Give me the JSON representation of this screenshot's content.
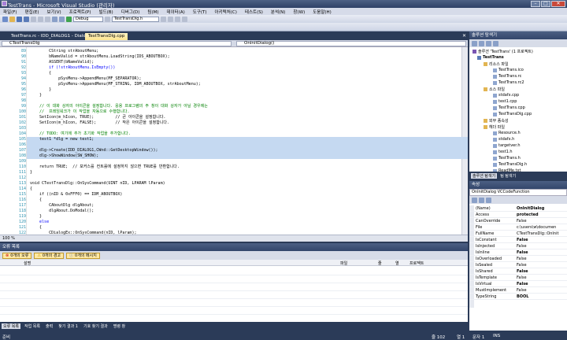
{
  "window": {
    "title": "TestTrans - Microsoft Visual Studio (관리자)"
  },
  "menu": [
    "파일(F)",
    "편집(E)",
    "보기(V)",
    "프로젝트(P)",
    "빌드(B)",
    "디버그(D)",
    "팀(M)",
    "데이터(A)",
    "도구(T)",
    "아키텍처(C)",
    "테스트(S)",
    "분석(N)",
    "창(W)",
    "도움말(H)"
  ],
  "toolbar": {
    "config": "Debug",
    "target": "TestTransDlg.h"
  },
  "tabs": [
    "TestTrans.rc - IDD_DIALOG1 - Dialog",
    "TestTransDlg.cpp"
  ],
  "nav": {
    "class": "CTestTransDlg",
    "member": "OnInitDialog()"
  },
  "code": [
    {
      "n": "89",
      "t": "        CString strAboutMenu;",
      "c": ""
    },
    {
      "n": "90",
      "t": "        bNameValid = strAboutMenu.LoadString(IDS_ABOUTBOX);",
      "c": ""
    },
    {
      "n": "91",
      "t": "        ASSERT(bNameValid);",
      "c": ""
    },
    {
      "n": "92",
      "t": "        if (!strAboutMenu.IsEmpty())",
      "c": "kw"
    },
    {
      "n": "93",
      "t": "        {",
      "c": ""
    },
    {
      "n": "94",
      "t": "            pSysMenu->AppendMenu(MF_SEPARATOR);",
      "c": ""
    },
    {
      "n": "95",
      "t": "            pSysMenu->AppendMenu(MF_STRING, IDM_ABOUTBOX, strAboutMenu);",
      "c": ""
    },
    {
      "n": "96",
      "t": "        }",
      "c": ""
    },
    {
      "n": "97",
      "t": "    }",
      "c": ""
    },
    {
      "n": "98",
      "t": "",
      "c": ""
    },
    {
      "n": "99",
      "t": "    // 이 대화 상자의 아이콘을 설정합니다. 응용 프로그램의 주 창이 대화 상자가 아닐 경우에는",
      "c": "cm"
    },
    {
      "n": "100",
      "t": "    //  프레임워크가 이 작업을 자동으로 수행합니다.",
      "c": "cm"
    },
    {
      "n": "101",
      "t": "    SetIcon(m_hIcon, TRUE);         // 큰 아이콘을 설정합니다.",
      "c": ""
    },
    {
      "n": "102",
      "t": "    SetIcon(m_hIcon, FALSE);        // 작은 아이콘을 설정합니다.",
      "c": ""
    },
    {
      "n": "103",
      "t": "",
      "c": ""
    },
    {
      "n": "104",
      "t": "    // TODO: 여기에 추가 초기화 작업을 추가합니다.",
      "c": "cm"
    },
    {
      "n": "105",
      "t": "    test1 *dlg = new test1;",
      "c": ""
    },
    {
      "n": "106",
      "t": "",
      "c": ""
    },
    {
      "n": "107",
      "t": "    dlg->Create(IDD_DIALOG1,CWnd::GetDesktopWindow());",
      "c": ""
    },
    {
      "n": "108",
      "t": "    dlg->ShowWindow(SW_SHOW);",
      "c": ""
    },
    {
      "n": "109",
      "t": "",
      "c": ""
    },
    {
      "n": "110",
      "t": "    return TRUE;  // 포커스를 컨트롤에 설정하지 않으면 TRUE를 반환합니다.",
      "c": ""
    },
    {
      "n": "111",
      "t": "}",
      "c": ""
    },
    {
      "n": "112",
      "t": "",
      "c": ""
    },
    {
      "n": "113",
      "t": "void CTestTransDlg::OnSysCommand(UINT nID, LPARAM lParam)",
      "c": ""
    },
    {
      "n": "114",
      "t": "{",
      "c": ""
    },
    {
      "n": "115",
      "t": "    if ((nID & 0xFFF0) == IDM_ABOUTBOX)",
      "c": ""
    },
    {
      "n": "116",
      "t": "    {",
      "c": ""
    },
    {
      "n": "117",
      "t": "        CAboutDlg dlgAbout;",
      "c": ""
    },
    {
      "n": "118",
      "t": "        dlgAbout.DoModal();",
      "c": ""
    },
    {
      "n": "119",
      "t": "    }",
      "c": ""
    },
    {
      "n": "120",
      "t": "    else",
      "c": "kw"
    },
    {
      "n": "121",
      "t": "    {",
      "c": ""
    },
    {
      "n": "122",
      "t": "        CDialogEx::OnSysCommand(nID, lParam);",
      "c": ""
    },
    {
      "n": "123",
      "t": "    }",
      "c": ""
    }
  ],
  "selected_lines": [
    "105",
    "106",
    "107",
    "108"
  ],
  "zoom": "100 %",
  "errorlist": {
    "title": "오류 목록",
    "errors": "0개의 오류",
    "warnings": "0개의 경고",
    "messages": "0개의 메시지",
    "columns": [
      "설명",
      "파일",
      "줄",
      "열",
      "프로젝트"
    ]
  },
  "bottom_tabs": [
    "오류 목록",
    "작업 목록",
    "출력",
    "찾기 결과 1",
    "기호 찾기 결과",
    "명령 창"
  ],
  "solution": {
    "title": "솔루션 탐색기",
    "items": [
      {
        "label": "솔루션 'TestTrans' (1 프로젝트)",
        "kind": "sln"
      },
      {
        "label": "TestTrans",
        "kind": "proj"
      },
      {
        "label": "리소스 파일",
        "kind": "folder"
      },
      {
        "label": "TestTrans.ico",
        "kind": "file"
      },
      {
        "label": "TestTrans.rc",
        "kind": "file"
      },
      {
        "label": "TestTrans.rc2",
        "kind": "file"
      },
      {
        "label": "소스 파일",
        "kind": "folder"
      },
      {
        "label": "stdafx.cpp",
        "kind": "file"
      },
      {
        "label": "test1.cpp",
        "kind": "file"
      },
      {
        "label": "TestTrans.cpp",
        "kind": "file"
      },
      {
        "label": "TestTransDlg.cpp",
        "kind": "file"
      },
      {
        "label": "외부 종속성",
        "kind": "folder"
      },
      {
        "label": "헤더 파일",
        "kind": "folder"
      },
      {
        "label": "Resource.h",
        "kind": "file"
      },
      {
        "label": "stdafx.h",
        "kind": "file"
      },
      {
        "label": "targetver.h",
        "kind": "file"
      },
      {
        "label": "test1.h",
        "kind": "file"
      },
      {
        "label": "TestTrans.h",
        "kind": "file"
      },
      {
        "label": "TestTransDlg.h",
        "kind": "file"
      },
      {
        "label": "ReadMe.txt",
        "kind": "file"
      }
    ],
    "tabs": [
      "솔루션 탐색기",
      "팀 탐색기"
    ]
  },
  "properties": {
    "title": "속성",
    "combo": "OnInitDialog  VCCodeFunction",
    "rows": [
      {
        "k": "(Name)",
        "v": "OnInitDialog",
        "b": true
      },
      {
        "k": "Access",
        "v": "protected",
        "b": true
      },
      {
        "k": "CanOverride",
        "v": "False",
        "b": false
      },
      {
        "k": "File",
        "v": "c:\\users\\w\\documen",
        "b": false
      },
      {
        "k": "FullName",
        "v": "CTestTransDlg::OnInit",
        "b": false
      },
      {
        "k": "IsConstant",
        "v": "False",
        "b": true
      },
      {
        "k": "IsInjected",
        "v": "False",
        "b": false
      },
      {
        "k": "IsInline",
        "v": "False",
        "b": true
      },
      {
        "k": "IsOverloaded",
        "v": "False",
        "b": false
      },
      {
        "k": "IsSealed",
        "v": "False",
        "b": false
      },
      {
        "k": "IsShared",
        "v": "False",
        "b": true
      },
      {
        "k": "IsTemplate",
        "v": "False",
        "b": false
      },
      {
        "k": "IsVirtual",
        "v": "False",
        "b": true
      },
      {
        "k": "MustImplement",
        "v": "False",
        "b": false
      },
      {
        "k": "TypeString",
        "v": "BOOL",
        "b": true
      }
    ]
  },
  "status": {
    "left": "준비",
    "ln": "줄 102",
    "col": "열 1",
    "ch": "문자 1",
    "ins": "INS"
  }
}
